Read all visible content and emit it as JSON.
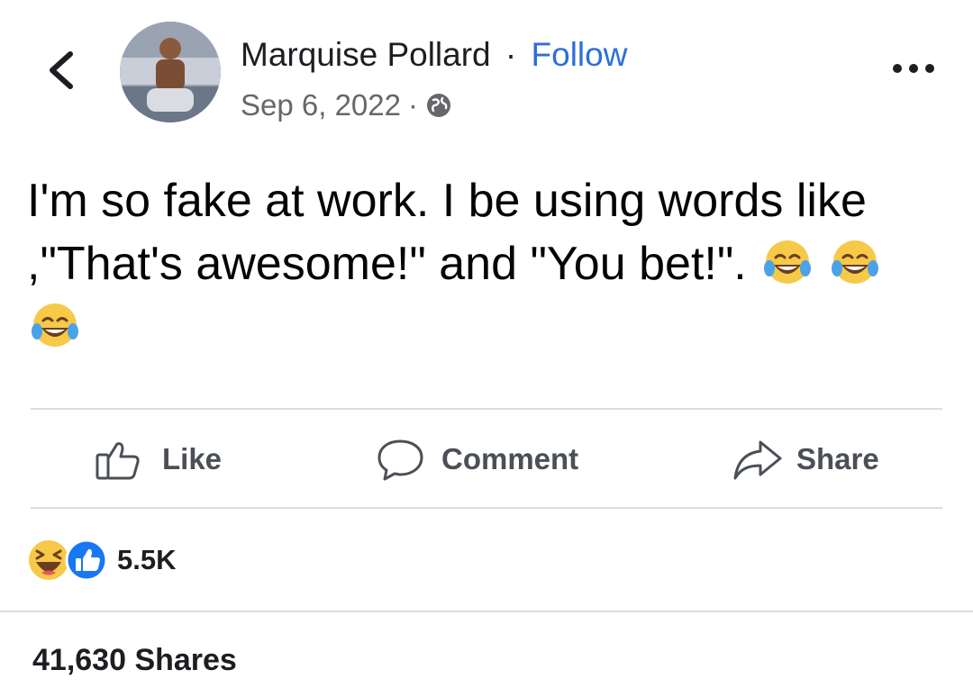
{
  "header": {
    "author": "Marquise Pollard",
    "separator": "·",
    "follow_label": "Follow",
    "date": "Sep 6, 2022",
    "privacy_icon": "globe-icon",
    "back_icon": "chevron-left-icon",
    "more_icon": "more-icon"
  },
  "post": {
    "text": "I'm so fake at work. I be using words like ,\"That's awesome!\" and \"You bet!\".",
    "emojis": [
      "face-with-tears-of-joy",
      "face-with-tears-of-joy",
      "face-with-tears-of-joy"
    ]
  },
  "actions": [
    {
      "label": "Like",
      "icon": "thumbs-up-icon"
    },
    {
      "label": "Comment",
      "icon": "comment-icon"
    },
    {
      "label": "Share",
      "icon": "share-icon"
    }
  ],
  "reactions": {
    "icons": [
      "haha-icon",
      "like-icon"
    ],
    "count": "5.5K"
  },
  "shares_label": "41,630 Shares",
  "colors": {
    "link": "#2d6fd6",
    "meta": "#65676b",
    "divider": "#dadde1",
    "like_blue": "#1877f2",
    "emoji_yellow": "#f7c948"
  }
}
